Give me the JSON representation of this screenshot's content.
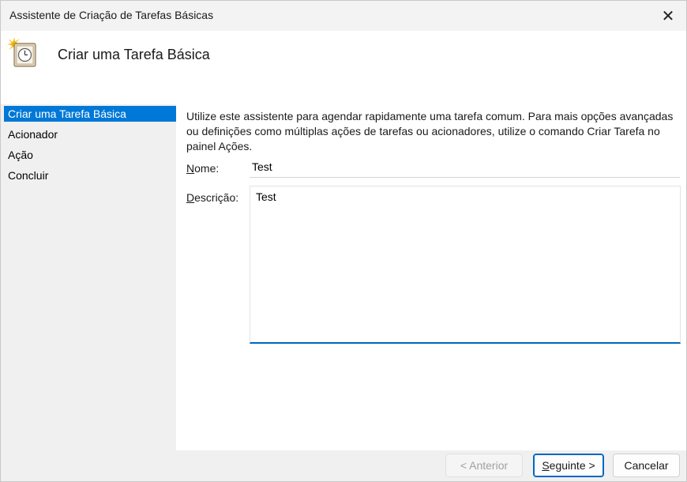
{
  "window": {
    "title": "Assistente de Criação de Tarefas Básicas",
    "close_glyph": "✕"
  },
  "header": {
    "icon": "task-clock-icon",
    "title": "Criar uma Tarefa Básica"
  },
  "nav": {
    "items": [
      {
        "label": "Criar uma Tarefa Básica",
        "selected": true
      },
      {
        "label": "Acionador",
        "selected": false
      },
      {
        "label": "Ação",
        "selected": false
      },
      {
        "label": "Concluir",
        "selected": false
      }
    ]
  },
  "main": {
    "intro": "Utilize este assistente para agendar rapidamente uma tarefa comum. Para mais opções avançadas ou definições como múltiplas ações de tarefas ou acionadores, utilize o comando Criar Tarefa no painel Ações.",
    "name_label_pre": "",
    "name_label_ul": "N",
    "name_label_post": "ome:",
    "name_value": "Test",
    "desc_label_pre": "",
    "desc_label_ul": "D",
    "desc_label_post": "escrição:",
    "desc_value": "Test"
  },
  "buttons": {
    "back_label": "< Anterior",
    "next_ul": "S",
    "next_rest": "eguinte >",
    "cancel_label": "Cancelar"
  },
  "colors": {
    "accent": "#0078d7",
    "focus": "#0067c0"
  }
}
